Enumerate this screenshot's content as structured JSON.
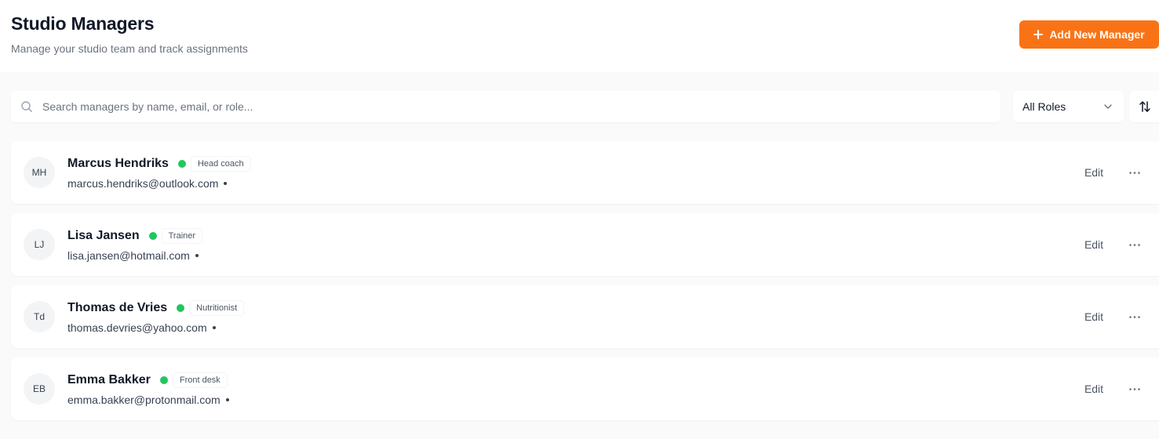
{
  "header": {
    "title": "Studio Managers",
    "subtitle": "Manage your studio team and track assignments",
    "add_button_label": "Add New Manager"
  },
  "toolbar": {
    "search_placeholder": "Search managers by name, email, or role...",
    "search_value": "",
    "role_filter_value": "All Roles"
  },
  "managers": [
    {
      "initials": "MH",
      "name": "Marcus Hendriks",
      "role": "Head coach",
      "email": "marcus.hendriks@outlook.com",
      "edit_label": "Edit"
    },
    {
      "initials": "LJ",
      "name": "Lisa Jansen",
      "role": "Trainer",
      "email": "lisa.jansen@hotmail.com",
      "edit_label": "Edit"
    },
    {
      "initials": "Td",
      "name": "Thomas de Vries",
      "role": "Nutritionist",
      "email": "thomas.devries@yahoo.com",
      "edit_label": "Edit"
    },
    {
      "initials": "EB",
      "name": "Emma Bakker",
      "role": "Front desk",
      "email": "emma.bakker@protonmail.com",
      "edit_label": "Edit"
    }
  ],
  "colors": {
    "accent": "#f97316",
    "status_active": "#22c55e"
  },
  "icons": {
    "add": "plus-icon",
    "search": "search-icon",
    "filter": "chevron-down-icon",
    "sort": "sort-icon",
    "row_menu": "more-horizontal-icon"
  }
}
